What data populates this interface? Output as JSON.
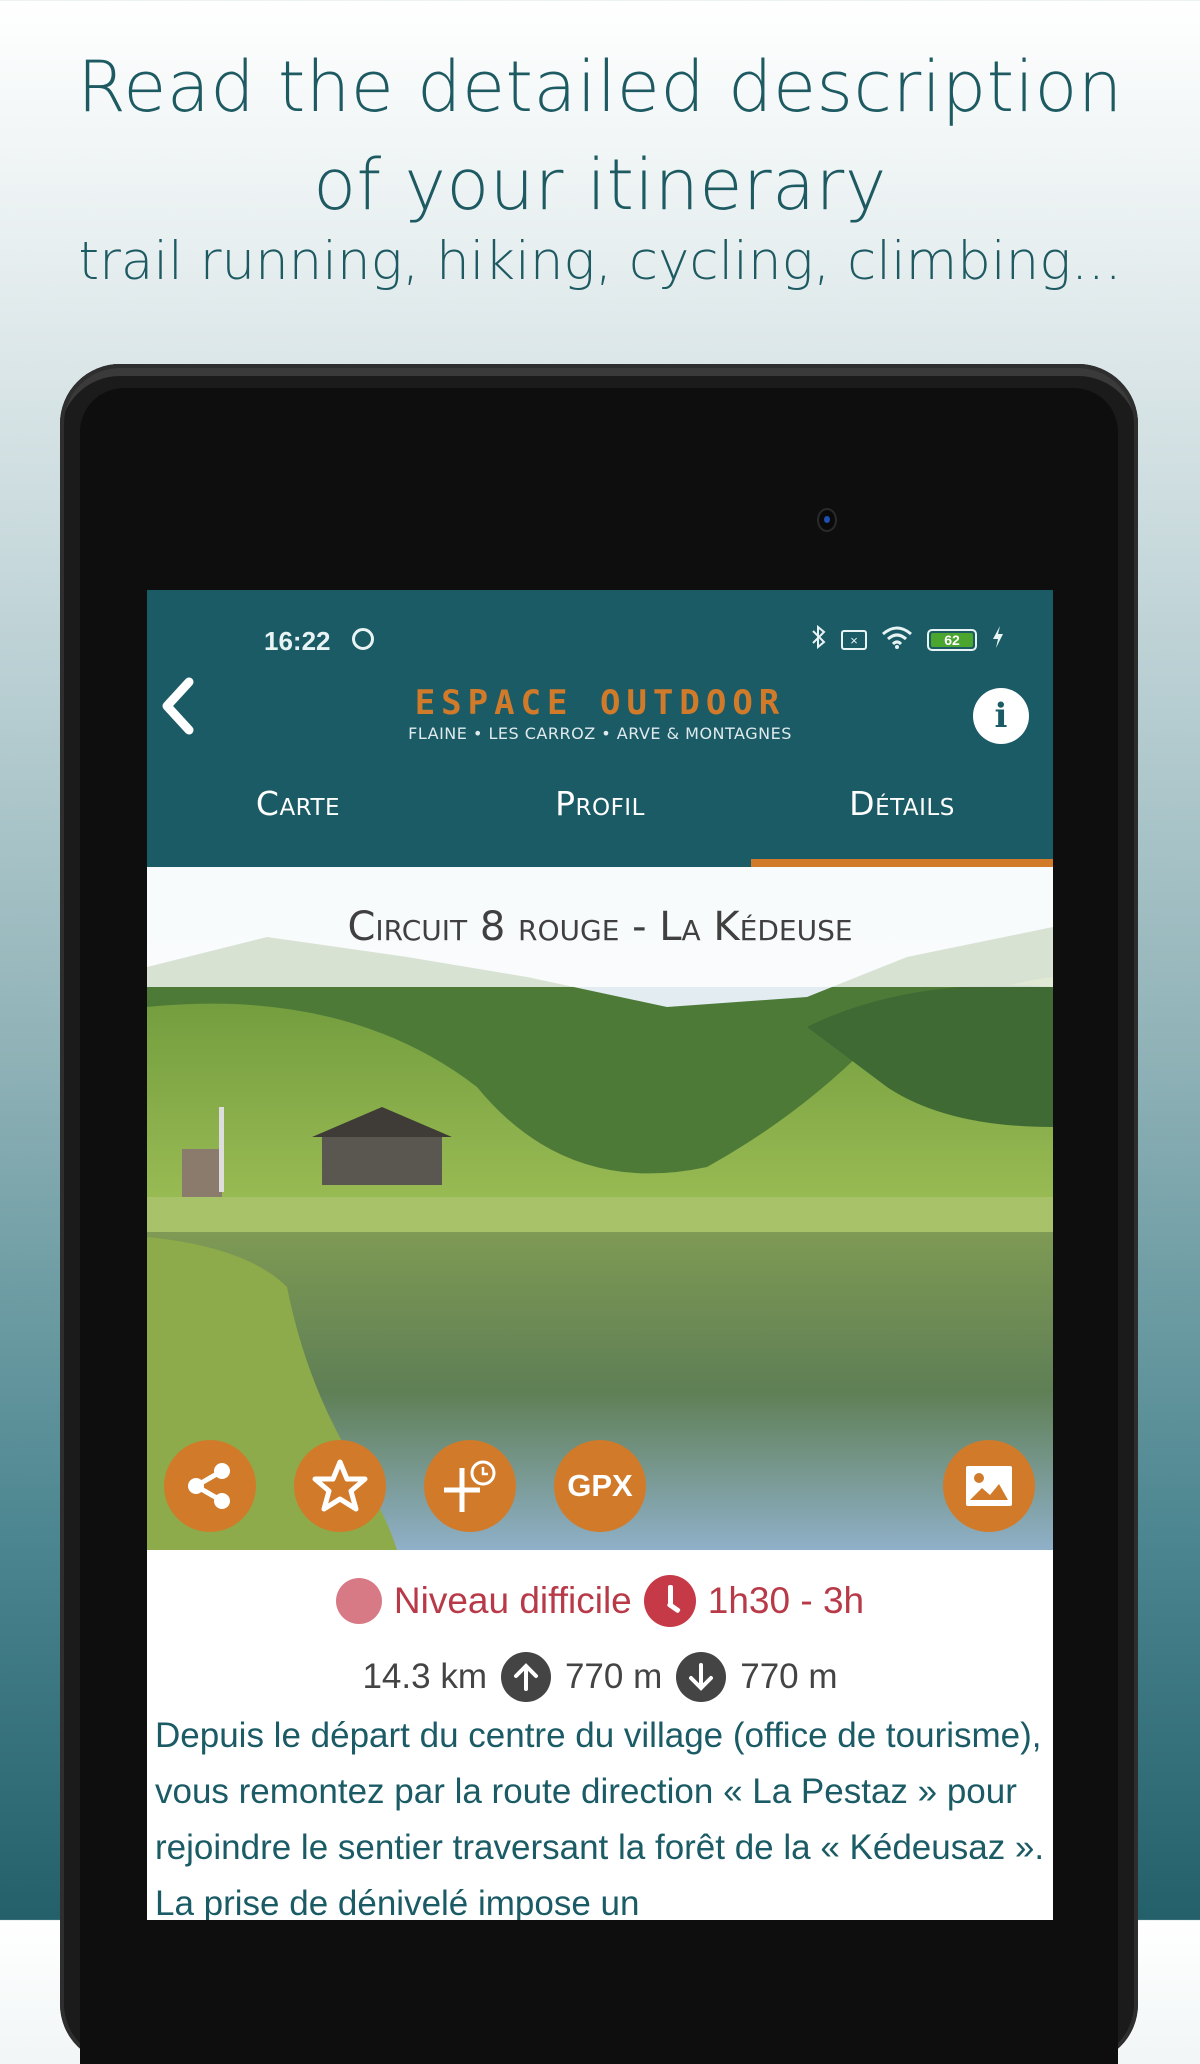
{
  "promo": {
    "title_line1": "Read the detailed description",
    "title_line2": "of your itinerary",
    "subtitle": "trail running, hiking, cycling, climbing..."
  },
  "status_bar": {
    "time": "16:22",
    "battery_level": "62",
    "icons": [
      "do-not-disturb-icon",
      "bluetooth-icon",
      "no-sim-icon",
      "wifi-icon",
      "battery-icon",
      "charging-icon"
    ]
  },
  "app_header": {
    "brand": "ESPACE OUTDOOR",
    "brand_tagline": "FLAINE • LES CARROZ • ARVE & MONTAGNES",
    "info_label": "i"
  },
  "tabs": [
    {
      "label": "Carte",
      "active": false
    },
    {
      "label": "Profil",
      "active": false
    },
    {
      "label": "Détails",
      "active": true
    }
  ],
  "route": {
    "title": "Circuit 8 rouge - La Kédeuse",
    "level": "Niveau difficile",
    "duration": "1h30 - 3h",
    "distance": "14.3 km",
    "ascent": "770 m",
    "descent": "770 m",
    "description": "Depuis le départ du centre du village (office de tourisme), vous remontez par la route direction « La Pestaz » pour rejoindre le sentier traversant la forêt de la « Kédeusaz ». La prise de dénivelé impose un"
  },
  "actions": {
    "gpx_label": "GPX"
  },
  "colors": {
    "primary": "#1b5b66",
    "accent": "#d17b2a",
    "difficulty": "#b83a48"
  }
}
